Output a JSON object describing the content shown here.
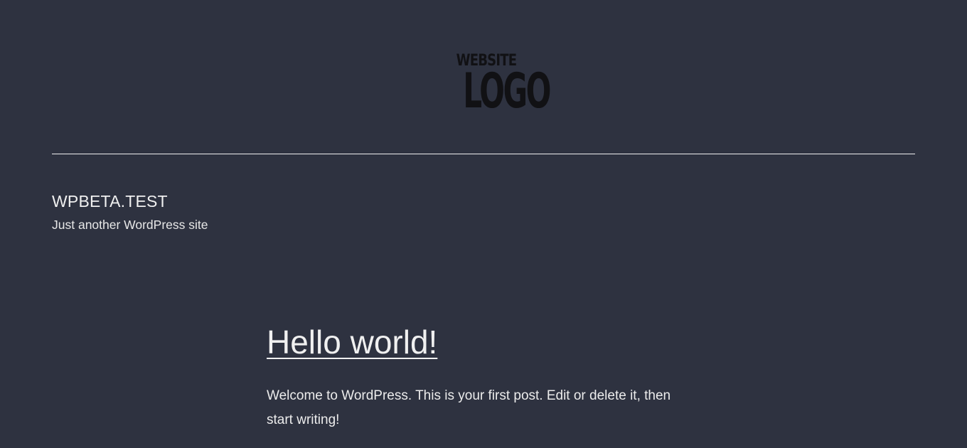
{
  "header": {
    "logo": {
      "line1": "WEBSITE",
      "line2": "LOGO",
      "color": "#111114"
    }
  },
  "site": {
    "title": "WPBETA.TEST",
    "tagline": "Just another WordPress site"
  },
  "post": {
    "title": "Hello world!",
    "excerpt": "Welcome to WordPress. This is your first post. Edit or delete it, then start writing!"
  },
  "colors": {
    "background": "#2e3240",
    "text": "#f0f0f0"
  }
}
